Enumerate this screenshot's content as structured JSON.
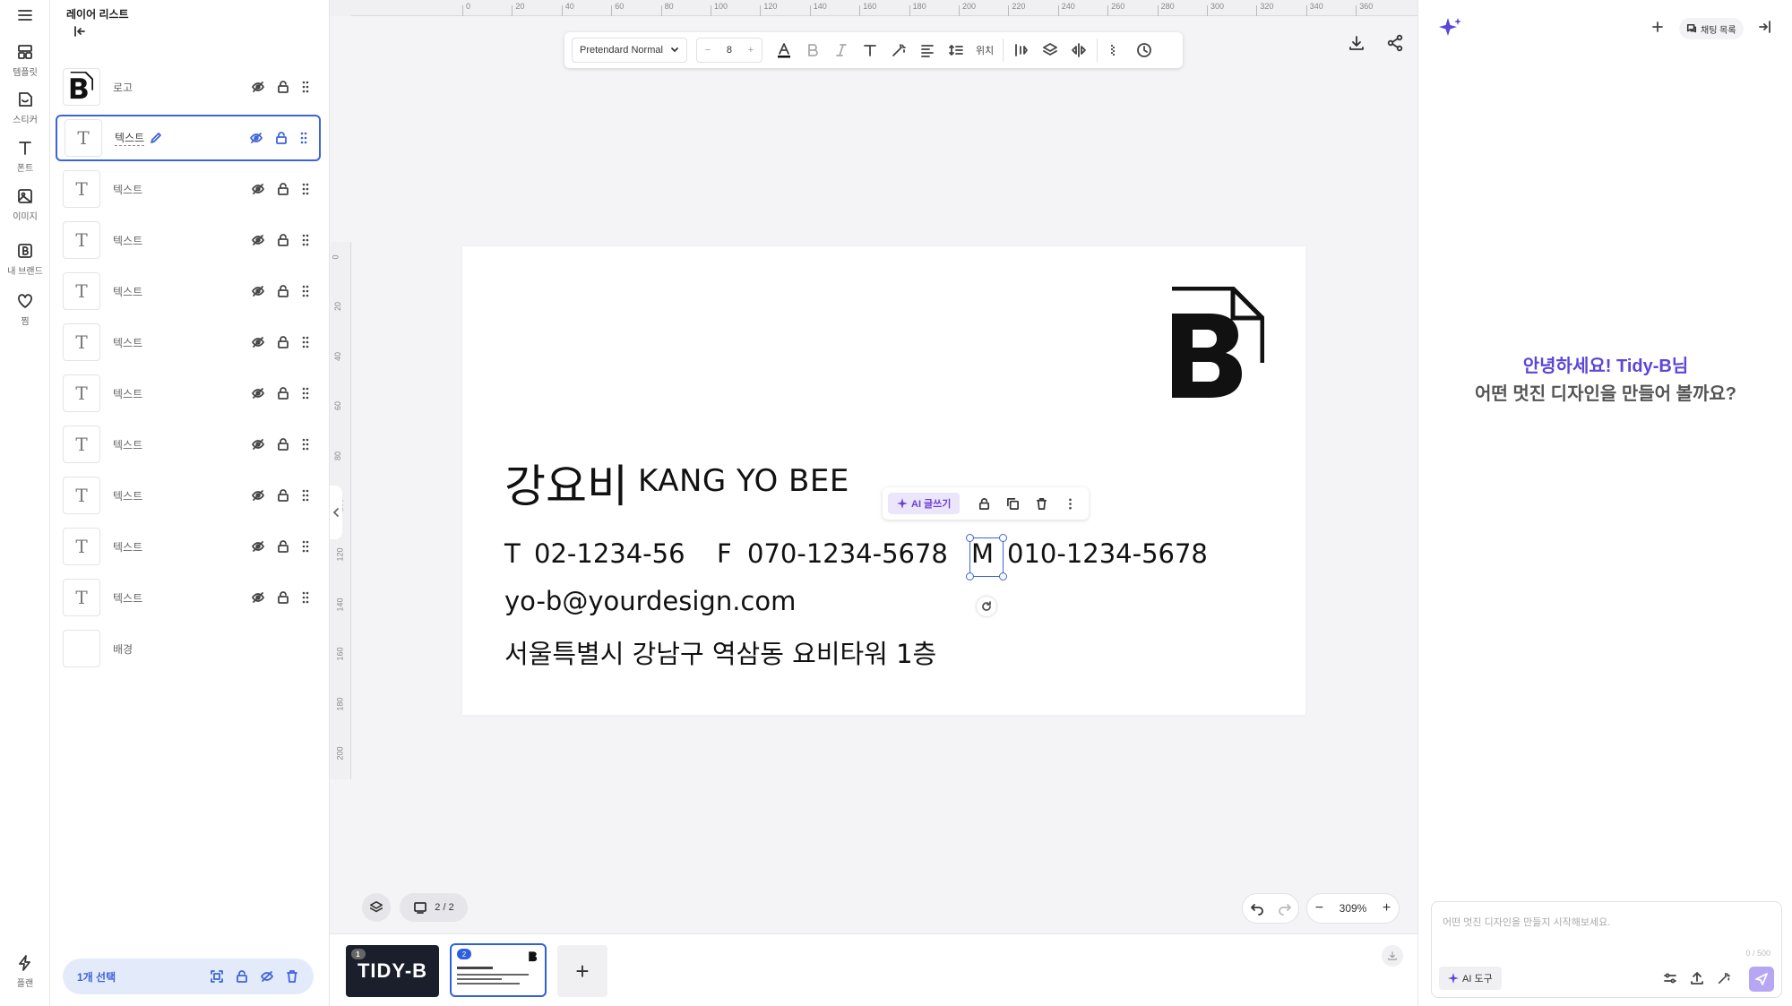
{
  "rail": {
    "items": [
      {
        "label": "템플릿",
        "icon": "template-icon"
      },
      {
        "label": "스티커",
        "icon": "sticker-icon"
      },
      {
        "label": "폰트",
        "icon": "font-icon"
      },
      {
        "label": "이미지",
        "icon": "image-icon"
      },
      {
        "label": "내 브랜드",
        "icon": "brand-icon"
      },
      {
        "label": "찜",
        "icon": "heart-icon"
      }
    ],
    "bottom_label": "플랜"
  },
  "layers": {
    "title": "레이어 리스트",
    "rows": [
      {
        "name": "로고",
        "thumb": "logo"
      },
      {
        "name": "텍스트",
        "thumb": "T",
        "selected": true
      },
      {
        "name": "텍스트",
        "thumb": "T"
      },
      {
        "name": "텍스트",
        "thumb": "T"
      },
      {
        "name": "텍스트",
        "thumb": "T"
      },
      {
        "name": "텍스트",
        "thumb": "T"
      },
      {
        "name": "텍스트",
        "thumb": "T"
      },
      {
        "name": "텍스트",
        "thumb": "T"
      },
      {
        "name": "텍스트",
        "thumb": "T"
      },
      {
        "name": "텍스트",
        "thumb": "T"
      },
      {
        "name": "텍스트",
        "thumb": "T"
      },
      {
        "name": "배경",
        "thumb": ""
      }
    ],
    "selection_label": "1개 선택"
  },
  "ruler": {
    "top_ticks": [
      "0",
      "20",
      "40",
      "60",
      "80",
      "100",
      "120",
      "140",
      "160",
      "180",
      "200",
      "220",
      "240",
      "260",
      "280",
      "300",
      "320",
      "340",
      "360"
    ],
    "left_ticks": [
      "0",
      "20",
      "40",
      "60",
      "80",
      "100",
      "120",
      "140",
      "160",
      "180",
      "200"
    ]
  },
  "toolbar": {
    "font_family": "Pretendard Normal",
    "font_size": "8",
    "position_label": "위치"
  },
  "card": {
    "name_ko": "강요비",
    "name_en": "KANG YO BEE",
    "phone_prefix": "T",
    "phone": "02-1234-56",
    "fax_prefix": "F",
    "fax": "070-1234-5678",
    "mobile_prefix": "M",
    "mobile": "010-1234-5678",
    "email": "yo-b@yourdesign.com",
    "address": "서울특별시 강남구 역삼동 요비타워 1층"
  },
  "floating": {
    "ai_label": "AI 글쓰기"
  },
  "canvas_controls": {
    "page_counter": "2 / 2",
    "zoom": "309%"
  },
  "pages": [
    {
      "num": "1",
      "label": "TIDY-B"
    },
    {
      "num": "2",
      "label": ""
    }
  ],
  "right_panel": {
    "chat_list_label": "채팅 목록",
    "greeting_line1": "안녕하세요! Tidy-B님",
    "greeting_line2": "어떤 멋진 디자인을 만들어 볼까요?",
    "input_placeholder": "어떤 멋진 디자인을 만들지 시작해보세요.",
    "char_count": "0 / 500",
    "ai_tool_label": "AI 도구"
  },
  "colors": {
    "accent": "#3e63d8",
    "ai_purple": "#5b46d8",
    "send_button": "#b7a6f3"
  }
}
